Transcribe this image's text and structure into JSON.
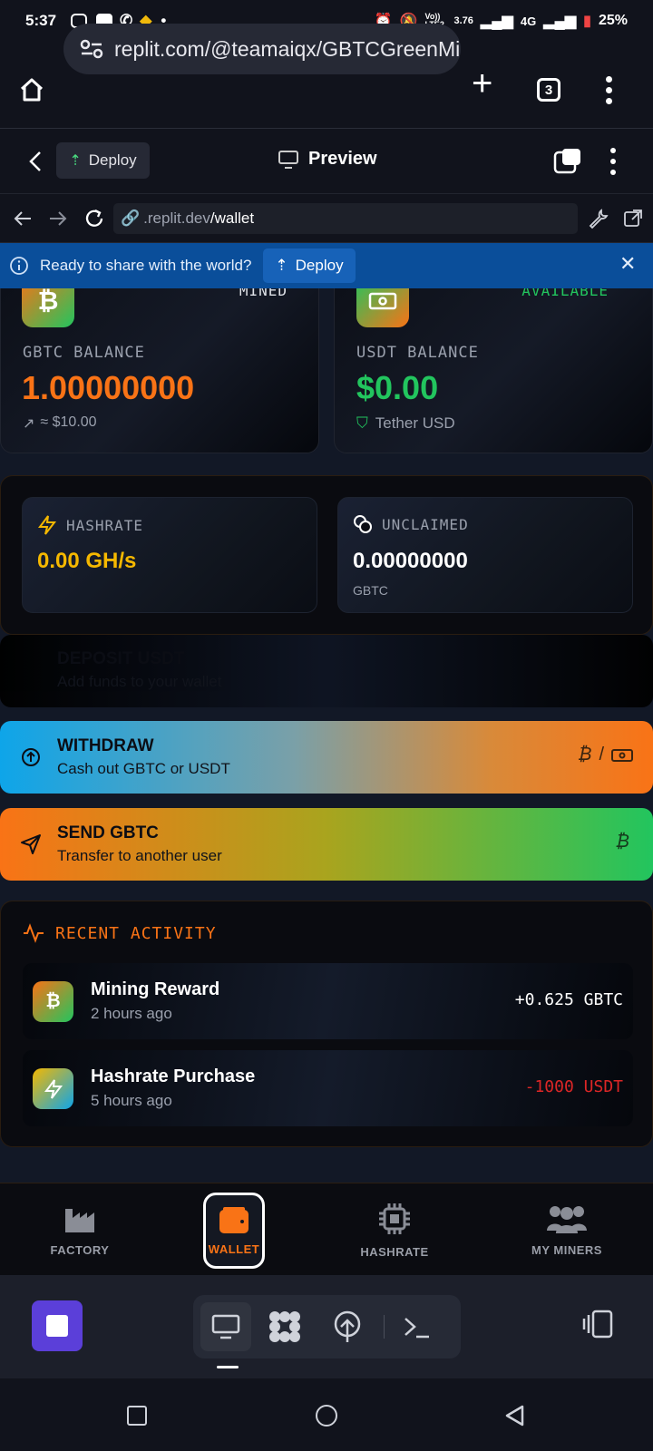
{
  "status_bar": {
    "time": "5:37",
    "network_speed": "3.76",
    "network": "4G",
    "battery": "25%",
    "volte": "Vo)) LTE2"
  },
  "browser": {
    "url": "replit.com/@teamaiqx/GBTCGreenMi",
    "tab_count": "3"
  },
  "replit_header": {
    "deploy_label": "Deploy",
    "preview_label": "Preview"
  },
  "inner_nav": {
    "url_prefix": ".replit.dev",
    "url_path": "/wallet"
  },
  "banner": {
    "text": "Ready to share with the world?",
    "deploy_label": "Deploy"
  },
  "balances": {
    "gbtc": {
      "tag": "MINED",
      "label": "GBTC BALANCE",
      "value": "1.00000000",
      "sub": "≈ $10.00"
    },
    "usdt": {
      "tag": "AVAILABLE",
      "label": "USDT BALANCE",
      "value": "$0.00",
      "sub": "Tether USD"
    }
  },
  "stats": {
    "hashrate": {
      "label": "HASHRATE",
      "value": "0.00 GH/s"
    },
    "unclaimed": {
      "label": "UNCLAIMED",
      "value": "0.00000000",
      "unit": "GBTC"
    }
  },
  "actions": {
    "deposit": {
      "title": "DEPOSIT USDT",
      "subtitle": "Add funds to your wallet"
    },
    "withdraw": {
      "title": "WITHDRAW",
      "subtitle": "Cash out GBTC or USDT",
      "right": "/"
    },
    "send": {
      "title": "SEND GBTC",
      "subtitle": "Transfer to another user"
    }
  },
  "activity": {
    "heading": "RECENT ACTIVITY",
    "items": [
      {
        "title": "Mining Reward",
        "time": "2 hours ago",
        "amount": "+0.625 GBTC"
      },
      {
        "title": "Hashrate Purchase",
        "time": "5 hours ago",
        "amount": "-1000 USDT"
      }
    ]
  },
  "bottom_nav": {
    "items": [
      {
        "label": "FACTORY"
      },
      {
        "label": "WALLET"
      },
      {
        "label": "HASHRATE"
      },
      {
        "label": "MY MINERS"
      }
    ]
  },
  "colors": {
    "orange": "#f97316",
    "green": "#22c55e",
    "gold": "#f5b800",
    "red": "#dc2626",
    "banner_blue": "#0a4e9a"
  }
}
